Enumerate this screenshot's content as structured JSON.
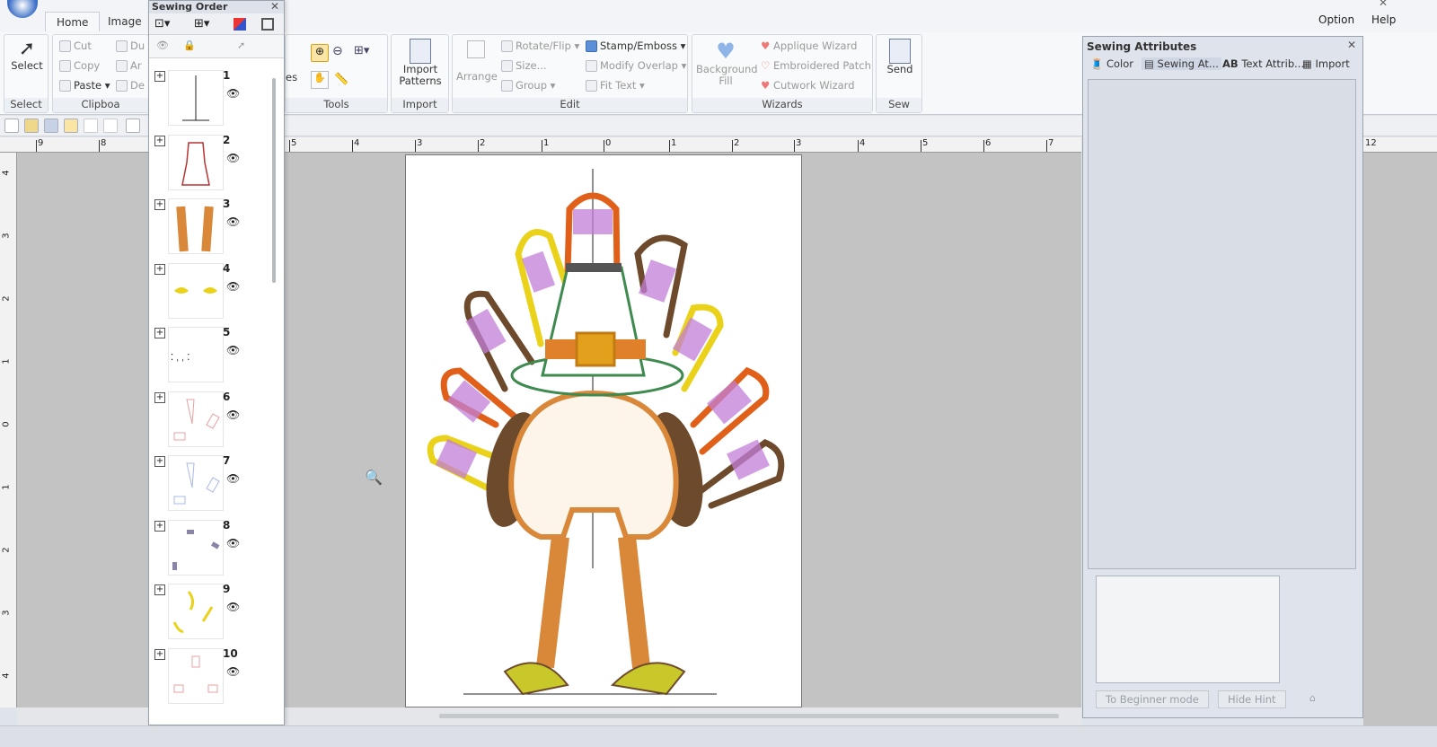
{
  "app": {
    "tabs": [
      "Home",
      "Image"
    ],
    "menu": {
      "option": "Option",
      "help": "Help"
    }
  },
  "ribbon": {
    "select": {
      "big": "Select",
      "label": "Select"
    },
    "clipboard": {
      "cut": "Cut",
      "copy": "Copy",
      "paste": "Paste",
      "du": "Du",
      "ar": "Ar",
      "de": "De",
      "label": "Clipboa"
    },
    "tools": {
      "es": "es",
      "label": "Tools"
    },
    "import": {
      "big": "Import Patterns",
      "label": "Import"
    },
    "edit": {
      "arrange": "Arrange",
      "rotate": "Rotate/Flip",
      "stamp": "Stamp/Emboss",
      "size": "Size...",
      "modify": "Modify Overlap",
      "group": "Group",
      "fittext": "Fit Text",
      "label": "Edit"
    },
    "wizards": {
      "bgfill": "Background Fill",
      "applique": "Applique Wizard",
      "patch": "Embroidered Patch",
      "cutwork": "Cutwork Wizard",
      "label": "Wizards"
    },
    "sew": {
      "big": "Send",
      "label": "Sew"
    }
  },
  "sewing_order": {
    "title": "Sewing Order",
    "items": [
      {
        "num": "1"
      },
      {
        "num": "2"
      },
      {
        "num": "3"
      },
      {
        "num": "4"
      },
      {
        "num": "5"
      },
      {
        "num": "6"
      },
      {
        "num": "7"
      },
      {
        "num": "8"
      },
      {
        "num": "9"
      },
      {
        "num": "10"
      }
    ]
  },
  "ruler": {
    "top": [
      "9",
      "8",
      "5",
      "4",
      "3",
      "2",
      "1",
      "0",
      "1",
      "2",
      "3",
      "4",
      "5",
      "6",
      "7",
      "12"
    ],
    "left": [
      "4",
      "3",
      "2",
      "1",
      "0",
      "1",
      "2",
      "3",
      "4"
    ]
  },
  "attributes": {
    "title": "Sewing Attributes",
    "tabs": [
      "Color",
      "Sewing At...",
      "Text Attrib...",
      "Import"
    ],
    "beginner": "To Beginner mode",
    "hidehint": "Hide Hint"
  },
  "colors": {
    "orange": "#e0601a",
    "purple": "#c27ed8",
    "brown": "#6e4a2c",
    "yellow": "#ead21a",
    "green": "#3f8a4f",
    "tan": "#d9883a",
    "gold": "#e3a01c"
  }
}
